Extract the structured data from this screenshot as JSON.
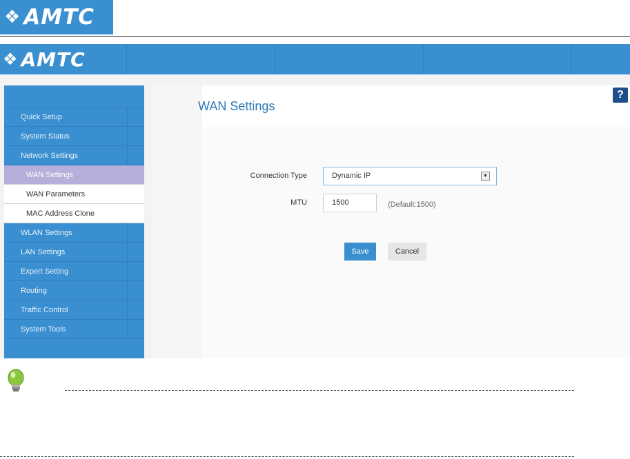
{
  "brand": {
    "logo_text": "AMTC",
    "logo_glyph": "❖",
    "colors": {
      "header_blue": "#3a8fd0",
      "active_item": "#b8aedb",
      "title_blue": "#2a78b8",
      "help_navy": "#1f4f8a"
    }
  },
  "sidebar": {
    "items": [
      {
        "label": "Quick Setup"
      },
      {
        "label": "System Status"
      },
      {
        "label": "Network Settings"
      }
    ],
    "sub_items": [
      {
        "label": "WAN Settings",
        "active": true
      },
      {
        "label": "WAN Parameters"
      },
      {
        "label": "MAC Address Clone"
      }
    ],
    "items_after": [
      {
        "label": "WLAN Settings"
      },
      {
        "label": "LAN Settings"
      },
      {
        "label": "Expert Setting"
      },
      {
        "label": "Routing"
      },
      {
        "label": "Traffic Control"
      },
      {
        "label": "System Tools"
      }
    ]
  },
  "page": {
    "title": "WAN Settings",
    "help_icon": "?",
    "connection_type": {
      "label": "Connection Type",
      "value": "Dynamic IP"
    },
    "mtu": {
      "label": "MTU",
      "value": "1500",
      "hint": "(Default:1500)"
    },
    "save_label": "Save",
    "cancel_label": "Cancel"
  },
  "icons": {
    "help": "question-icon",
    "select_arrow": "chevron-down-icon",
    "tip": "lightbulb-icon"
  }
}
